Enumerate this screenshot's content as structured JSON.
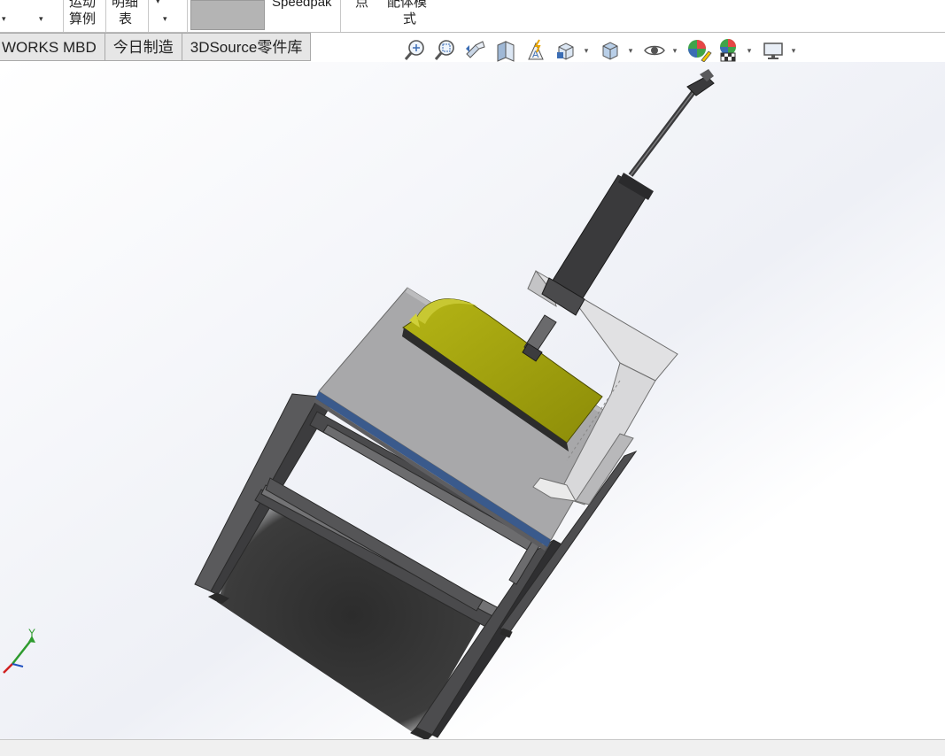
{
  "ribbon": {
    "group1_caret": "▾",
    "motion_study_line1": "运动",
    "motion_study_line2": "算例",
    "bom_line1": "明细",
    "bom_line2": "表",
    "speedpak": "Speedpak",
    "dot": "点",
    "config_line1": "配体模",
    "config_line2": "式"
  },
  "tabs": [
    "WORKS MBD",
    "今日制造",
    "3DSource零件库"
  ],
  "heads_up_toolbar": [
    {
      "icon": "zoom-to-fit-icon",
      "dropdown": false
    },
    {
      "icon": "zoom-to-area-icon",
      "dropdown": false
    },
    {
      "icon": "previous-view-icon",
      "dropdown": false
    },
    {
      "icon": "section-view-icon",
      "dropdown": false
    },
    {
      "icon": "dynamic-annotation-icon",
      "dropdown": false
    },
    {
      "icon": "view-orientation-icon",
      "dropdown": true
    },
    {
      "icon": "display-style-icon",
      "dropdown": true
    },
    {
      "icon": "hide-show-items-icon",
      "dropdown": true
    },
    {
      "icon": "edit-appearance-icon",
      "dropdown": false
    },
    {
      "icon": "apply-scene-icon",
      "dropdown": true
    },
    {
      "icon": "view-settings-icon",
      "dropdown": true
    }
  ],
  "triad": {
    "y_label": "Y"
  },
  "colors": {
    "table_top": "#a8a8aa",
    "frame": "#4a4a4c",
    "yellow_guard": "#9c9c0c",
    "bracket": "#d8d8d8",
    "edge_blue": "#3a5a8c"
  }
}
